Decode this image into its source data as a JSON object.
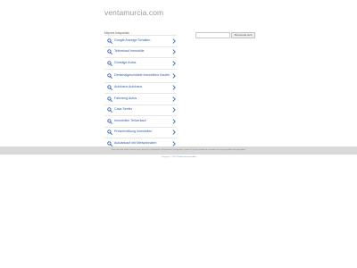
{
  "site": {
    "name": "ventamurcia.com"
  },
  "search": {
    "placeholder": "",
    "button_label": "Búsqueda web"
  },
  "related": {
    "title": "Mejores búsquedas",
    "items": [
      {
        "label": "Google Anzeige Schalten"
      },
      {
        "label": "Teilverkauf Immobilie"
      },
      {
        "label": "Günstige Autos"
      },
      {
        "label": "Denkmalgeschützte Immobilien Kaufen"
      },
      {
        "label": "Autohaus Autohaus"
      },
      {
        "label": "Fahrzeug Autos"
      },
      {
        "label": "Casa Senfer"
      },
      {
        "label": "Immobilien Teilverkauf"
      },
      {
        "label": "Preisermittlung Immobilien"
      },
      {
        "label": "Autoankauf mit Mietwohnaten"
      }
    ]
  },
  "footer": {
    "notice": "Este sitio web utiliza cookies para mejorar su experiencia. Al continuar navegando, acepta el uso de cookies de acuerdo con nuestra política de privacidad.",
    "copyright": "Copyright © 2024.",
    "link": "Política de privacidad"
  },
  "colors": {
    "link": "#2a5db0",
    "footer_band": "#d9d9d9"
  }
}
